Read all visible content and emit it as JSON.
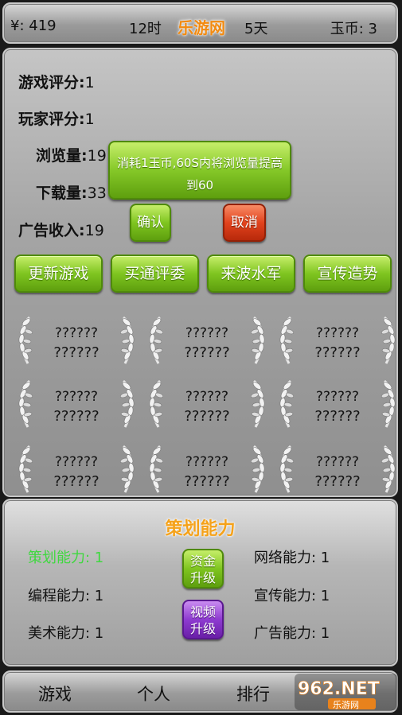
{
  "topbar": {
    "money": "¥: 419",
    "hour": "12时",
    "title": "乐游网",
    "days": "5天",
    "jade": "玉币: 3"
  },
  "stats": {
    "game_score": {
      "label": "游戏评分:",
      "value": "1"
    },
    "player_score": {
      "label": "玩家评分:",
      "value": "1"
    },
    "views": {
      "label": "浏览量:",
      "value": "19"
    },
    "downloads": {
      "label": "下载量:",
      "value": "33"
    },
    "ad_income": {
      "label": "广告收入:",
      "value": "19"
    }
  },
  "popup": {
    "message": "消耗1玉币,60S内将浏览量提高到60",
    "confirm": "确认",
    "cancel": "取消"
  },
  "actions": [
    "更新游戏",
    "买通评委",
    "来波水军",
    "宣传造势"
  ],
  "awards": [
    [
      "??????",
      "??????"
    ],
    [
      "??????",
      "??????"
    ],
    [
      "??????",
      "??????"
    ],
    [
      "??????",
      "??????"
    ],
    [
      "??????",
      "??????"
    ],
    [
      "??????",
      "??????"
    ],
    [
      "??????",
      "??????"
    ],
    [
      "??????",
      "??????"
    ],
    [
      "??????",
      "??????"
    ]
  ],
  "skills": {
    "title": "策划能力",
    "planning": "策划能力: 1",
    "programming": "编程能力: 1",
    "art": "美术能力: 1",
    "network": "网络能力: 1",
    "promotion": "宣传能力: 1",
    "ads": "广告能力: 1",
    "fund_upgrade": [
      "资金",
      "升级"
    ],
    "video_upgrade": [
      "视频",
      "升级"
    ]
  },
  "nav": [
    "游戏",
    "个人",
    "排行"
  ],
  "watermark": {
    "top": "962.NET",
    "bottom": "乐游网"
  },
  "colors": {
    "accent_orange": "#f28a10",
    "button_green": "#7fc520",
    "button_red": "#e2431d",
    "button_purple": "#8e3bd0",
    "active_skill": "#3fd83f"
  }
}
